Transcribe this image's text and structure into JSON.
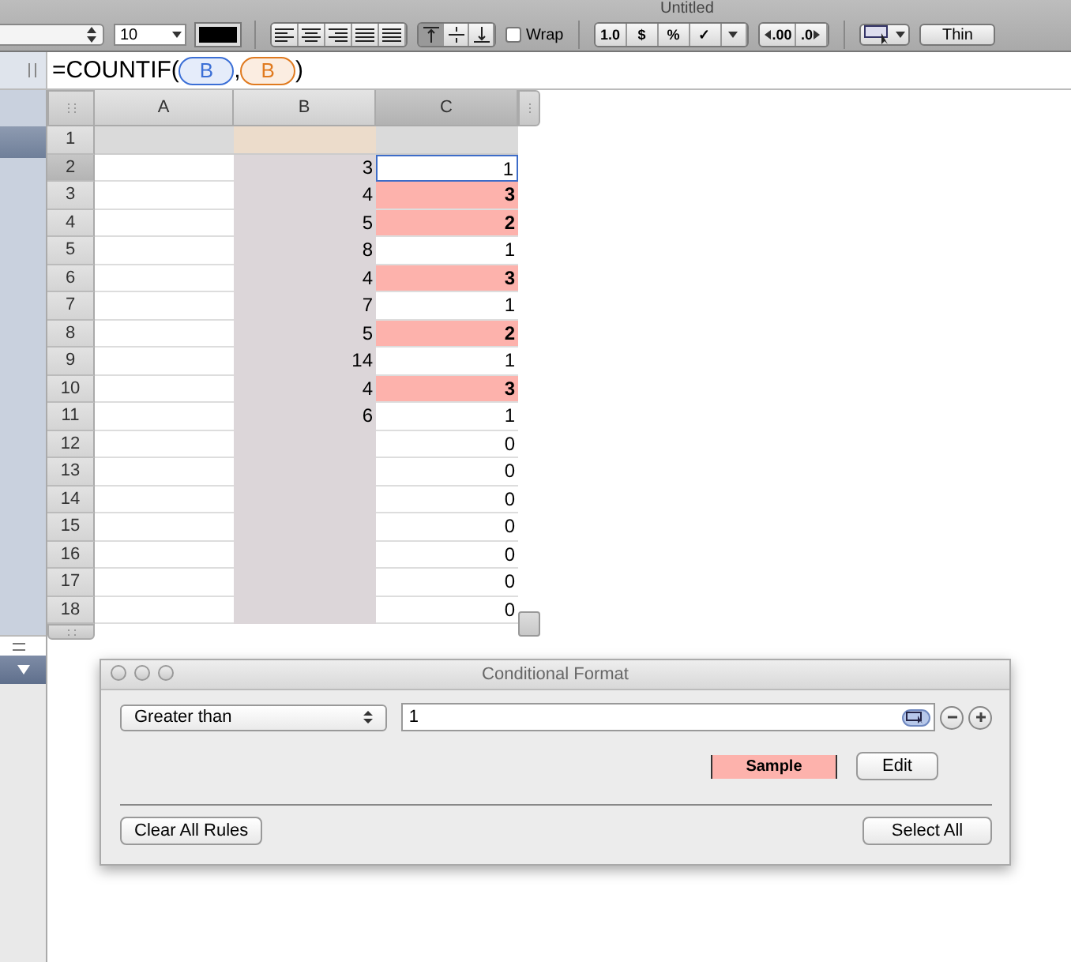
{
  "window": {
    "title": "Untitled"
  },
  "toolbar": {
    "font_size": "10",
    "wrap": {
      "label": "Wrap",
      "checked": false
    },
    "number_buttons": [
      "1.0",
      "$",
      "%",
      "✓"
    ],
    "decimal_buttons": [
      ".00",
      ".0"
    ],
    "border_style": "Thin"
  },
  "formula_bar": {
    "parts": [
      {
        "kind": "text",
        "text": "=COUNTIF("
      },
      {
        "kind": "ref",
        "text": "B",
        "color": "#3b6fd6"
      },
      {
        "kind": "text",
        "text": ","
      },
      {
        "kind": "ref",
        "text": "B",
        "color": "#e07a1f"
      },
      {
        "kind": "text",
        "text": ")"
      }
    ]
  },
  "sheet": {
    "columns": [
      {
        "label": "A",
        "selected": false
      },
      {
        "label": "B",
        "selected": false
      },
      {
        "label": "C",
        "selected": true
      }
    ],
    "rows": [
      {
        "label": "1",
        "header": true,
        "selected": false,
        "cells": [
          "",
          "",
          ""
        ],
        "highlighted": false
      },
      {
        "label": "2",
        "header": false,
        "selected": true,
        "cells": [
          "",
          "3",
          "1"
        ],
        "highlighted": false
      },
      {
        "label": "3",
        "header": false,
        "selected": false,
        "cells": [
          "",
          "4",
          "3"
        ],
        "highlighted": true
      },
      {
        "label": "4",
        "header": false,
        "selected": false,
        "cells": [
          "",
          "5",
          "2"
        ],
        "highlighted": true
      },
      {
        "label": "5",
        "header": false,
        "selected": false,
        "cells": [
          "",
          "8",
          "1"
        ],
        "highlighted": false
      },
      {
        "label": "6",
        "header": false,
        "selected": false,
        "cells": [
          "",
          "4",
          "3"
        ],
        "highlighted": true
      },
      {
        "label": "7",
        "header": false,
        "selected": false,
        "cells": [
          "",
          "7",
          "1"
        ],
        "highlighted": false
      },
      {
        "label": "8",
        "header": false,
        "selected": false,
        "cells": [
          "",
          "5",
          "2"
        ],
        "highlighted": true
      },
      {
        "label": "9",
        "header": false,
        "selected": false,
        "cells": [
          "",
          "14",
          "1"
        ],
        "highlighted": false
      },
      {
        "label": "10",
        "header": false,
        "selected": false,
        "cells": [
          "",
          "4",
          "3"
        ],
        "highlighted": true
      },
      {
        "label": "11",
        "header": false,
        "selected": false,
        "cells": [
          "",
          "6",
          "1"
        ],
        "highlighted": false
      },
      {
        "label": "12",
        "header": false,
        "selected": false,
        "cells": [
          "",
          "",
          "0"
        ],
        "highlighted": false
      },
      {
        "label": "13",
        "header": false,
        "selected": false,
        "cells": [
          "",
          "",
          "0"
        ],
        "highlighted": false
      },
      {
        "label": "14",
        "header": false,
        "selected": false,
        "cells": [
          "",
          "",
          "0"
        ],
        "highlighted": false
      },
      {
        "label": "15",
        "header": false,
        "selected": false,
        "cells": [
          "",
          "",
          "0"
        ],
        "highlighted": false
      },
      {
        "label": "16",
        "header": false,
        "selected": false,
        "cells": [
          "",
          "",
          "0"
        ],
        "highlighted": false
      },
      {
        "label": "17",
        "header": false,
        "selected": false,
        "cells": [
          "",
          "",
          "0"
        ],
        "highlighted": false
      },
      {
        "label": "18",
        "header": false,
        "selected": false,
        "cells": [
          "",
          "",
          "0"
        ],
        "highlighted": false
      }
    ]
  },
  "dialog": {
    "title": "Conditional Format",
    "condition": "Greater than",
    "value": "1",
    "sample": "Sample",
    "edit_button": "Edit",
    "clear_button": "Clear All Rules",
    "select_button": "Select All"
  }
}
